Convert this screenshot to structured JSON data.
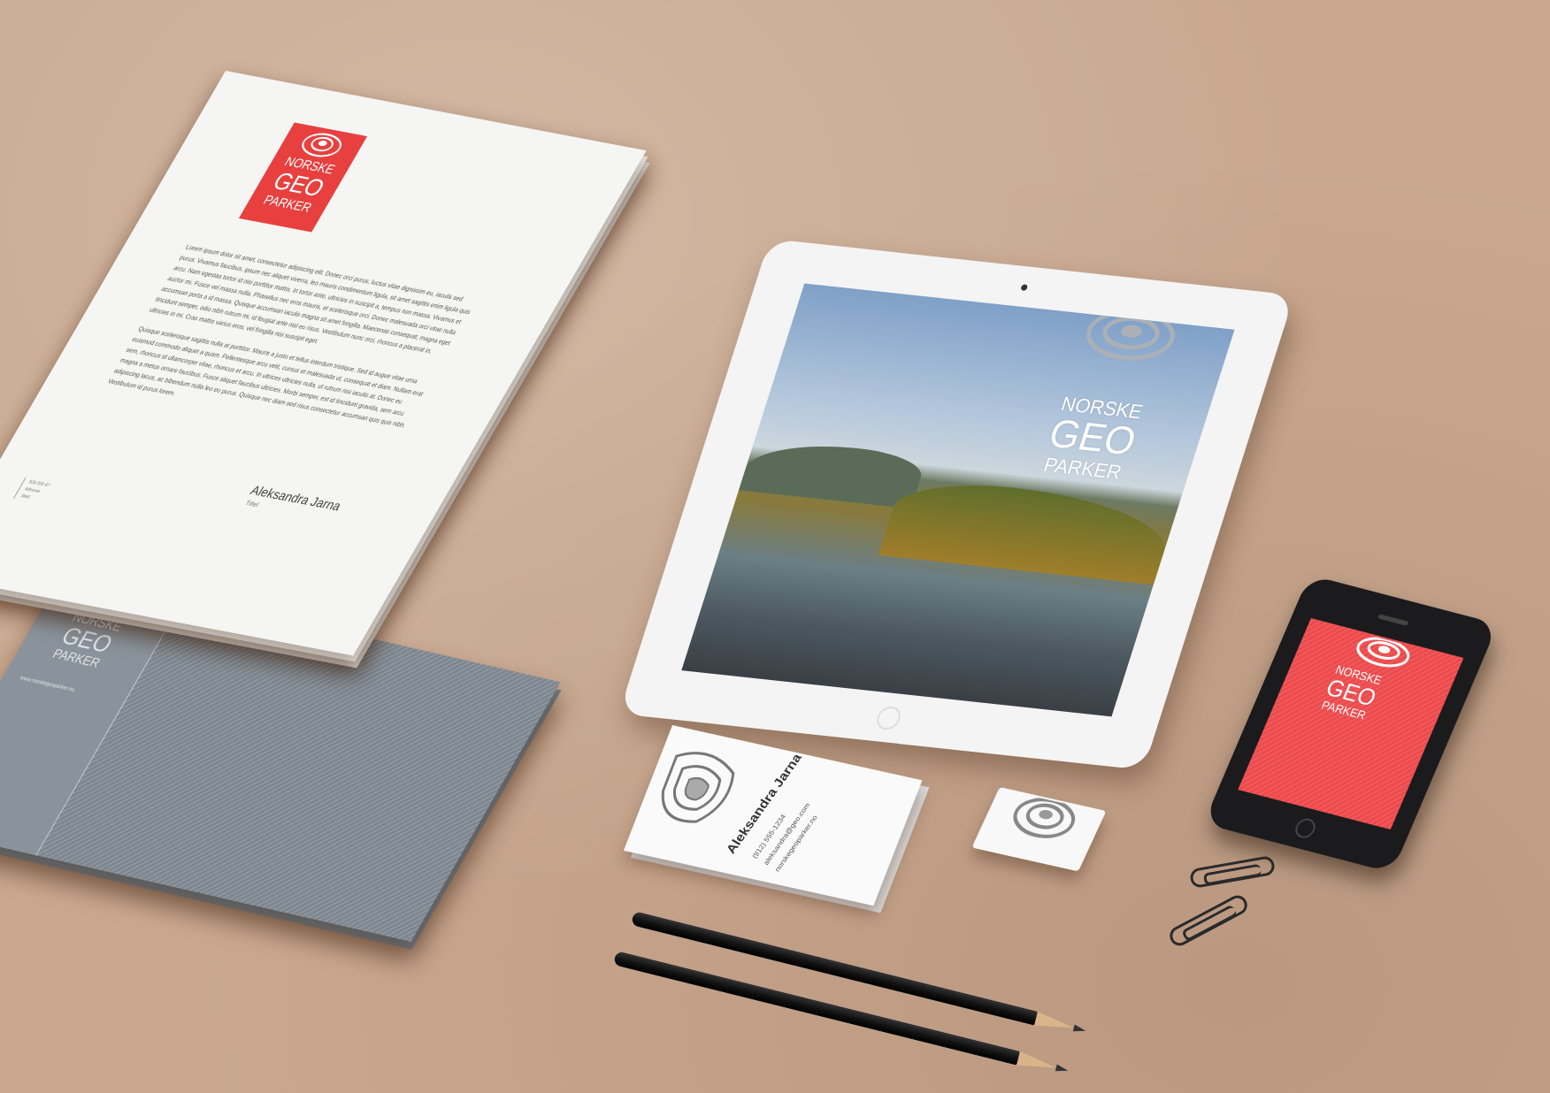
{
  "brand": {
    "line1": "NORSKE",
    "line2": "GEO",
    "line3": "PARKER",
    "accent_red": "#e8403f",
    "envelope_gray": "#7d868e"
  },
  "letter": {
    "paragraph1": "Lorem ipsum dolor sit amet, consectetur adipiscing elit. Donec orci purus, luctus vitae dignissim eu, iaculis sed purus. Vivamus faucibus, ipsum nec aliquet viverra, leo mauris condimentum ligula, sit amet sagittis enim ligula quis arcu. Nam egestas tortor id nisi porttitor mattis. In tortor ante, ultricies in suscipit a, tempus non massa. Vivamus et auctor mi. Fusce vel massa nulla. Phasellus nec eros mauris, et scelerisque orci. Donec malesuada orci vitae nulla accumsan porta a id massa. Quisque accumsan iaculis magna sit amet fringilla. Maecenas consequat, magna eget tincidunt semper, odio nibh rutrum mi, id feugiat ante nisl eu risus. Vestibulum nunc orci, rhoncus a placerat in, ultricies in mi. Cras mattis varius eros, vel fringilla nisi suscipit eget.",
    "paragraph2": "Quisque scelerisque sagittis nulla at porttitor. Mauris a justo et tellus interdum tristique. Sed id augue vitae urna euismod commodo aliquet a quam. Pellentesque arcu velit, cursus et malesuada ut, consequat et diam. Nullam erat sem, rhoncus id ullamcorper vitae, rhoncus et arcu. In ultrices ultricies nulla, ut rutrum nisi iaculis at. Donec eu magna a metus ornare faucibus. Fusce aliquet faucibus ultricies. Morbi semper, est id tincidunt gravida, sem arcu adipiscing lacus, ac bibendum nulla leo eu purus. Quisque nec diam sed risus consectetur accumsan quis quis nibh. Vestibulum id purus lorem.",
    "signature": "Aleksandra Jarna",
    "signature_title": "Tittel",
    "footer_line1": "926 030 47",
    "footer_line2": "Adresse",
    "footer_line3": "Sted"
  },
  "envelope": {
    "url": "www.norskegeoparker.no"
  },
  "card": {
    "name": "Aleksandra Jarna",
    "phone": "(912) 555-1234",
    "email": "aleksandra@geo.com",
    "website": "norskegeoparker.no"
  }
}
